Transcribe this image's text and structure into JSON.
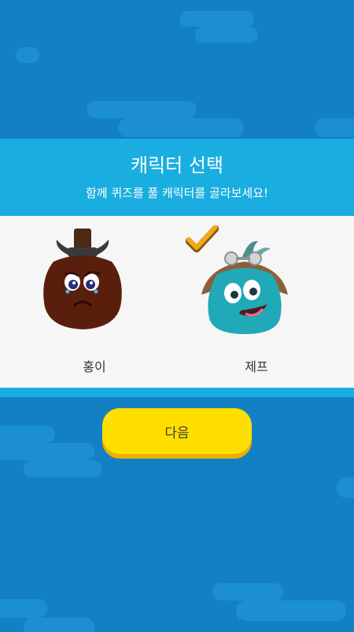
{
  "header": {
    "title": "캐릭터 선택",
    "subtitle": "함께 퀴즈를 풀 캐릭터를 골라보세요!"
  },
  "characters": [
    {
      "name": "홍이",
      "selected": false,
      "color": "#5a1f0c"
    },
    {
      "name": "제프",
      "selected": true,
      "color": "#21a9b8"
    }
  ],
  "next_button": {
    "label": "다음"
  },
  "colors": {
    "background": "#1380c4",
    "header": "#1aaee0",
    "panel": "#f6f6f6",
    "button": "#ffdf00",
    "check": "#f2a81d"
  }
}
